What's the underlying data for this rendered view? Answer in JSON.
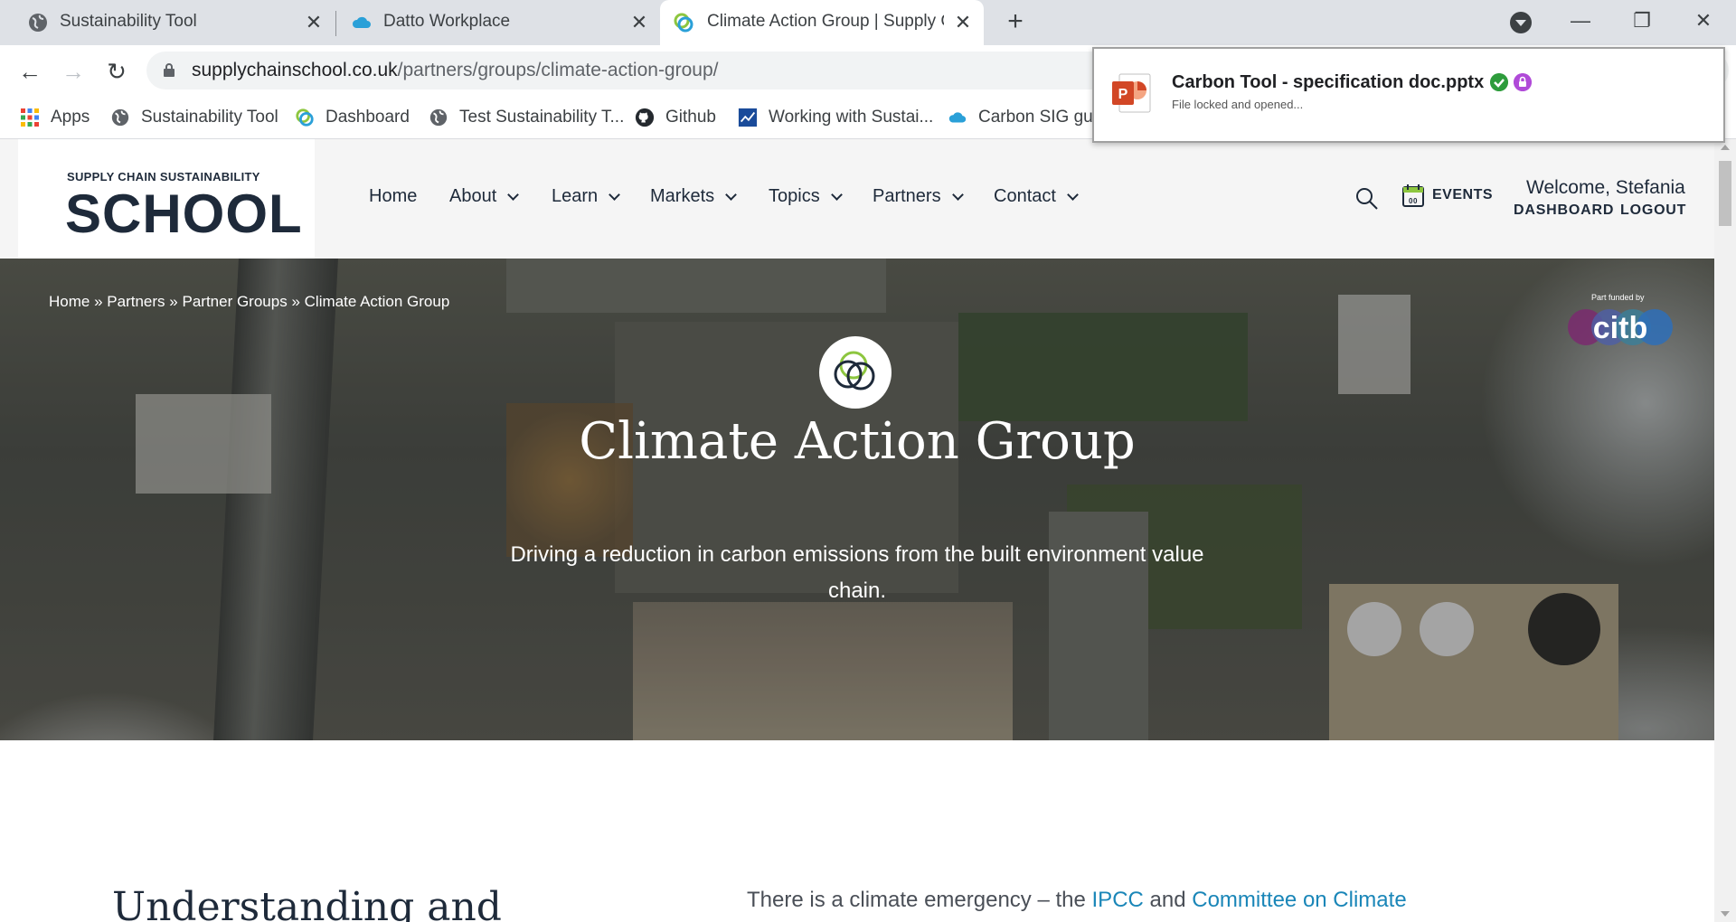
{
  "tabs": [
    {
      "title": "Sustainability Tool",
      "close": "✕",
      "icon": "globe-icon"
    },
    {
      "title": "Datto Workplace",
      "close": "✕",
      "icon": "cloud-icon"
    },
    {
      "title": "Climate Action Group | Supply Cl",
      "close": "✕",
      "icon": "site-logo-icon",
      "active": true
    }
  ],
  "new_tab": "+",
  "window": {
    "minimize": "—",
    "restore": "❐",
    "close": "✕"
  },
  "nav": {
    "back": "←",
    "forward": "→",
    "reload": "↻"
  },
  "address": {
    "domain": "supplychainschool.co.uk",
    "path": "/partners/groups/climate-action-group/"
  },
  "bookmarks": [
    {
      "label": "Apps",
      "icon": "apps-grid-icon"
    },
    {
      "label": "Sustainability Tool",
      "icon": "globe-icon"
    },
    {
      "label": "Dashboard",
      "icon": "site-logo-icon"
    },
    {
      "label": "Test Sustainability T...",
      "icon": "globe-icon"
    },
    {
      "label": "Github",
      "icon": "github-icon"
    },
    {
      "label": "Working with Sustai...",
      "icon": "chart-icon"
    },
    {
      "label": "Carbon SIG guid",
      "icon": "cloud-icon"
    }
  ],
  "toast": {
    "title": "Carbon Tool - specification doc.pptx",
    "subtitle": "File locked and opened...",
    "colors": {
      "check": "#2e9c3c",
      "lock": "#b04ad8",
      "ppt": "#d24726"
    }
  },
  "site": {
    "logo_small": "SUPPLY CHAIN SUSTAINABILITY",
    "logo_big": "SCHOOL",
    "menu": [
      "Home",
      "About",
      "Learn",
      "Markets",
      "Topics",
      "Partners",
      "Contact"
    ],
    "events": "EVENTS",
    "welcome": "Welcome, Stefania",
    "dashboard": "DASHBOARD",
    "logout": "LOGOUT"
  },
  "hero": {
    "breadcrumb": [
      "Home",
      "Partners",
      "Partner Groups",
      "Climate Action Group"
    ],
    "breadcrumb_sep": "»",
    "funded_small": "Part funded by",
    "funded_logo": "citb",
    "title": "Climate Action Group",
    "subtitle": "Driving a reduction in carbon emissions from the built environment value chain."
  },
  "content": {
    "heading": "Understanding and",
    "para_start": "There is a climate emergency – the ",
    "link1": "IPCC",
    "para_mid": " and ",
    "link2": "Committee on Climate"
  },
  "colors": {
    "navy": "#1e2a3a",
    "link": "#1a86b8",
    "brand_green": "#8dc63f"
  }
}
